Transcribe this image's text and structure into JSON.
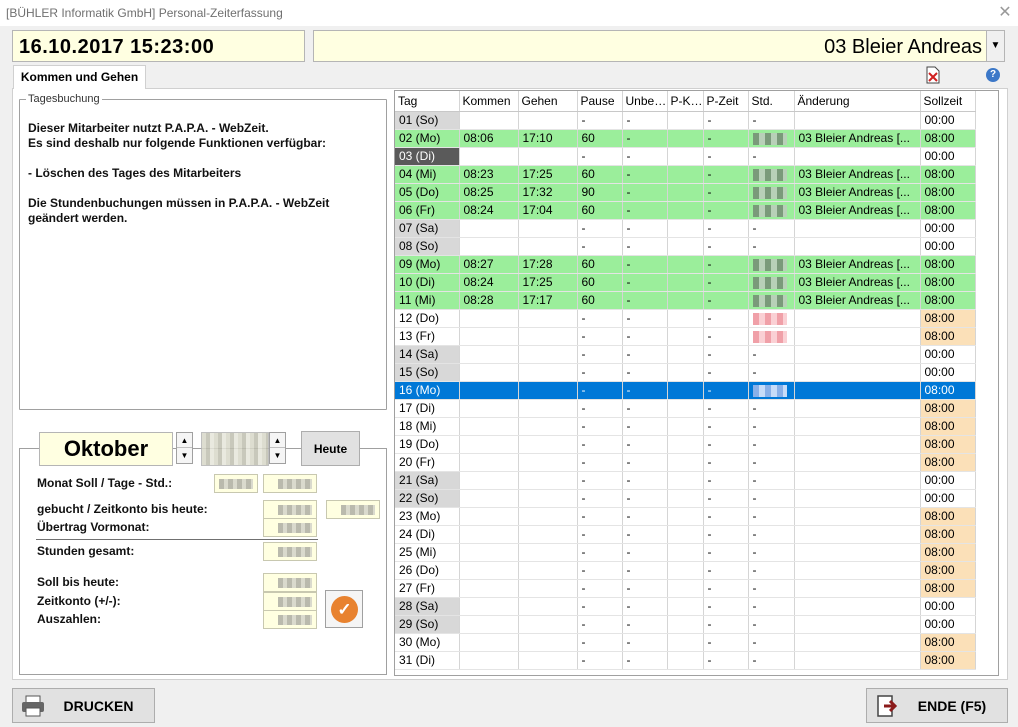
{
  "window": {
    "title": "[BÜHLER Informatik GmbH] Personal-Zeiterfassung"
  },
  "header": {
    "datetime": "16.10.2017 15:23:00",
    "employee": "03 Bleier Andreas"
  },
  "tab": {
    "label": "Kommen und Gehen"
  },
  "tagesbuchung": {
    "legend": "Tagesbuchung",
    "info": "Dieser Mitarbeiter nutzt P.A.P.A. - WebZeit.\nEs sind deshalb nur folgende Funktionen verfügbar:\n\n- Löschen des Tages des Mitarbeiters\n\nDie Stundenbuchungen müssen in P.A.P.A. - WebZeit\ngeändert werden."
  },
  "month": {
    "name": "Oktober",
    "today_label": "Heute",
    "labels": {
      "soll": "Monat Soll / Tage - Std.:",
      "gebucht": "gebucht / Zeitkonto bis heute:",
      "uebertrag": "Übertrag Vormonat:",
      "gesamt": "Stunden gesamt:",
      "soll_heute": "Soll bis heute:",
      "zeitkonto": "Zeitkonto (+/-):",
      "auszahlen": "Auszahlen:"
    }
  },
  "grid": {
    "columns": [
      "Tag",
      "Kommen",
      "Gehen",
      "Pause",
      "Unbe…",
      "P-K…",
      "P-Zeit",
      "Std.",
      "Änderung",
      "Sollzeit"
    ],
    "rows": [
      {
        "tag": "01 (So)",
        "kommen": "",
        "gehen": "",
        "pause": "-",
        "unbe": "-",
        "pk": "",
        "pzeit": "-",
        "std": "-",
        "aend": "",
        "soll": "00:00",
        "type": "weekend"
      },
      {
        "tag": "02 (Mo)",
        "kommen": "08:06",
        "gehen": "17:10",
        "pause": "60",
        "unbe": "-",
        "pk": "",
        "pzeit": "-",
        "std": "pix",
        "aend": "03 Bleier Andreas [...",
        "soll": "08:00",
        "type": "work"
      },
      {
        "tag": "03 (Di)",
        "kommen": "",
        "gehen": "",
        "pause": "-",
        "unbe": "-",
        "pk": "",
        "pzeit": "-",
        "std": "-",
        "aend": "",
        "soll": "00:00",
        "type": "holiday"
      },
      {
        "tag": "04 (Mi)",
        "kommen": "08:23",
        "gehen": "17:25",
        "pause": "60",
        "unbe": "-",
        "pk": "",
        "pzeit": "-",
        "std": "pix",
        "aend": "03 Bleier Andreas [...",
        "soll": "08:00",
        "type": "work"
      },
      {
        "tag": "05 (Do)",
        "kommen": "08:25",
        "gehen": "17:32",
        "pause": "90",
        "unbe": "-",
        "pk": "",
        "pzeit": "-",
        "std": "pix",
        "aend": "03 Bleier Andreas [...",
        "soll": "08:00",
        "type": "work"
      },
      {
        "tag": "06 (Fr)",
        "kommen": "08:24",
        "gehen": "17:04",
        "pause": "60",
        "unbe": "-",
        "pk": "",
        "pzeit": "-",
        "std": "pix",
        "aend": "03 Bleier Andreas [...",
        "soll": "08:00",
        "type": "work"
      },
      {
        "tag": "07 (Sa)",
        "kommen": "",
        "gehen": "",
        "pause": "-",
        "unbe": "-",
        "pk": "",
        "pzeit": "-",
        "std": "-",
        "aend": "",
        "soll": "00:00",
        "type": "weekend"
      },
      {
        "tag": "08 (So)",
        "kommen": "",
        "gehen": "",
        "pause": "-",
        "unbe": "-",
        "pk": "",
        "pzeit": "-",
        "std": "-",
        "aend": "",
        "soll": "00:00",
        "type": "weekend"
      },
      {
        "tag": "09 (Mo)",
        "kommen": "08:27",
        "gehen": "17:28",
        "pause": "60",
        "unbe": "-",
        "pk": "",
        "pzeit": "-",
        "std": "pix",
        "aend": "03 Bleier Andreas [...",
        "soll": "08:00",
        "type": "work"
      },
      {
        "tag": "10 (Di)",
        "kommen": "08:24",
        "gehen": "17:25",
        "pause": "60",
        "unbe": "-",
        "pk": "",
        "pzeit": "-",
        "std": "pix",
        "aend": "03 Bleier Andreas [...",
        "soll": "08:00",
        "type": "work"
      },
      {
        "tag": "11 (Mi)",
        "kommen": "08:28",
        "gehen": "17:17",
        "pause": "60",
        "unbe": "-",
        "pk": "",
        "pzeit": "-",
        "std": "pix",
        "aend": "03 Bleier Andreas [...",
        "soll": "08:00",
        "type": "work"
      },
      {
        "tag": "12 (Do)",
        "kommen": "",
        "gehen": "",
        "pause": "-",
        "unbe": "-",
        "pk": "",
        "pzeit": "-",
        "std": "pink",
        "aend": "",
        "soll": "08:00",
        "type": "due"
      },
      {
        "tag": "13 (Fr)",
        "kommen": "",
        "gehen": "",
        "pause": "-",
        "unbe": "-",
        "pk": "",
        "pzeit": "-",
        "std": "pink",
        "aend": "",
        "soll": "08:00",
        "type": "due"
      },
      {
        "tag": "14 (Sa)",
        "kommen": "",
        "gehen": "",
        "pause": "-",
        "unbe": "-",
        "pk": "",
        "pzeit": "-",
        "std": "-",
        "aend": "",
        "soll": "00:00",
        "type": "weekend"
      },
      {
        "tag": "15 (So)",
        "kommen": "",
        "gehen": "",
        "pause": "-",
        "unbe": "-",
        "pk": "",
        "pzeit": "-",
        "std": "-",
        "aend": "",
        "soll": "00:00",
        "type": "weekend"
      },
      {
        "tag": "16 (Mo)",
        "kommen": "",
        "gehen": "",
        "pause": "-",
        "unbe": "-",
        "pk": "",
        "pzeit": "-",
        "std": "blue",
        "aend": "",
        "soll": "08:00",
        "type": "sel"
      },
      {
        "tag": "17 (Di)",
        "kommen": "",
        "gehen": "",
        "pause": "-",
        "unbe": "-",
        "pk": "",
        "pzeit": "-",
        "std": "-",
        "aend": "",
        "soll": "08:00",
        "type": "due"
      },
      {
        "tag": "18 (Mi)",
        "kommen": "",
        "gehen": "",
        "pause": "-",
        "unbe": "-",
        "pk": "",
        "pzeit": "-",
        "std": "-",
        "aend": "",
        "soll": "08:00",
        "type": "due"
      },
      {
        "tag": "19 (Do)",
        "kommen": "",
        "gehen": "",
        "pause": "-",
        "unbe": "-",
        "pk": "",
        "pzeit": "-",
        "std": "-",
        "aend": "",
        "soll": "08:00",
        "type": "due"
      },
      {
        "tag": "20 (Fr)",
        "kommen": "",
        "gehen": "",
        "pause": "-",
        "unbe": "-",
        "pk": "",
        "pzeit": "-",
        "std": "-",
        "aend": "",
        "soll": "08:00",
        "type": "due"
      },
      {
        "tag": "21 (Sa)",
        "kommen": "",
        "gehen": "",
        "pause": "-",
        "unbe": "-",
        "pk": "",
        "pzeit": "-",
        "std": "-",
        "aend": "",
        "soll": "00:00",
        "type": "weekend"
      },
      {
        "tag": "22 (So)",
        "kommen": "",
        "gehen": "",
        "pause": "-",
        "unbe": "-",
        "pk": "",
        "pzeit": "-",
        "std": "-",
        "aend": "",
        "soll": "00:00",
        "type": "weekend"
      },
      {
        "tag": "23 (Mo)",
        "kommen": "",
        "gehen": "",
        "pause": "-",
        "unbe": "-",
        "pk": "",
        "pzeit": "-",
        "std": "-",
        "aend": "",
        "soll": "08:00",
        "type": "due"
      },
      {
        "tag": "24 (Di)",
        "kommen": "",
        "gehen": "",
        "pause": "-",
        "unbe": "-",
        "pk": "",
        "pzeit": "-",
        "std": "-",
        "aend": "",
        "soll": "08:00",
        "type": "due"
      },
      {
        "tag": "25 (Mi)",
        "kommen": "",
        "gehen": "",
        "pause": "-",
        "unbe": "-",
        "pk": "",
        "pzeit": "-",
        "std": "-",
        "aend": "",
        "soll": "08:00",
        "type": "due"
      },
      {
        "tag": "26 (Do)",
        "kommen": "",
        "gehen": "",
        "pause": "-",
        "unbe": "-",
        "pk": "",
        "pzeit": "-",
        "std": "-",
        "aend": "",
        "soll": "08:00",
        "type": "due"
      },
      {
        "tag": "27 (Fr)",
        "kommen": "",
        "gehen": "",
        "pause": "-",
        "unbe": "-",
        "pk": "",
        "pzeit": "-",
        "std": "-",
        "aend": "",
        "soll": "08:00",
        "type": "due"
      },
      {
        "tag": "28 (Sa)",
        "kommen": "",
        "gehen": "",
        "pause": "-",
        "unbe": "-",
        "pk": "",
        "pzeit": "-",
        "std": "-",
        "aend": "",
        "soll": "00:00",
        "type": "weekend"
      },
      {
        "tag": "29 (So)",
        "kommen": "",
        "gehen": "",
        "pause": "-",
        "unbe": "-",
        "pk": "",
        "pzeit": "-",
        "std": "-",
        "aend": "",
        "soll": "00:00",
        "type": "weekend"
      },
      {
        "tag": "30 (Mo)",
        "kommen": "",
        "gehen": "",
        "pause": "-",
        "unbe": "-",
        "pk": "",
        "pzeit": "-",
        "std": "-",
        "aend": "",
        "soll": "08:00",
        "type": "due"
      },
      {
        "tag": "31 (Di)",
        "kommen": "",
        "gehen": "",
        "pause": "-",
        "unbe": "-",
        "pk": "",
        "pzeit": "-",
        "std": "-",
        "aend": "",
        "soll": "08:00",
        "type": "due"
      }
    ]
  },
  "footer": {
    "print_label": "DRUCKEN",
    "end_label": "ENDE (F5)"
  },
  "colors": {
    "work": "#9bee9b",
    "selected": "#0078d7",
    "soll": "#fbe0b8",
    "field": "#ffffe1"
  }
}
